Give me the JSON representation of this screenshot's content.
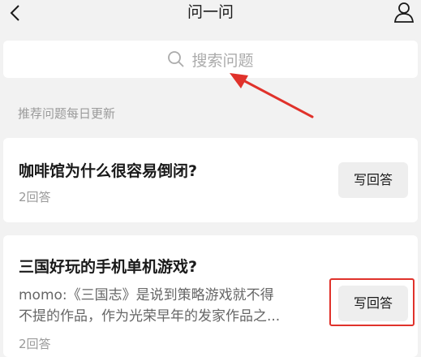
{
  "nav": {
    "title": "问一问",
    "back_icon": "chevron-left-icon",
    "profile_icon": "person-icon"
  },
  "search": {
    "placeholder": "搜索问题",
    "icon": "search-icon"
  },
  "hint": "推荐问题每日更新",
  "questions": [
    {
      "title": "咖啡馆为什么很容易倒闭?",
      "answers": "2回答",
      "button": "写回答"
    },
    {
      "title": "三国好玩的手机单机游戏?",
      "excerpt_line1": "momo:《三国志》是说到策略游戏就不得",
      "excerpt_line2": "不提的作品，作为光荣早年的发家作品之...",
      "answers": "2回答",
      "button": "写回答"
    }
  ],
  "colors": {
    "annotation": "#e0322b",
    "background": "#f2f2f2",
    "card": "#ffffff",
    "button": "#eeeeee"
  }
}
